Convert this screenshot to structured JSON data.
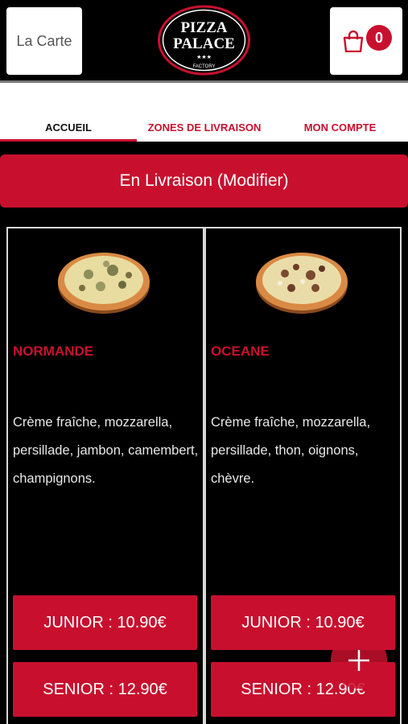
{
  "header": {
    "carte_label": "La Carte",
    "logo_text_line1": "PIZZA",
    "logo_text_line2": "PALACE",
    "logo_stars": "★★★",
    "logo_sub": "FACTORY",
    "cart_count": "0"
  },
  "nav": {
    "tabs": [
      {
        "label": "ACCUEIL"
      },
      {
        "label": "ZONES DE LIVRAISON"
      },
      {
        "label": "MON COMPTE"
      }
    ]
  },
  "delivery": {
    "label": "En Livraison (Modifier)"
  },
  "products": [
    {
      "name": "NORMANDE",
      "description": "Crème fraîche, mozzarella, persillade, jambon, camembert, champignons.",
      "junior": "JUNIOR : 10.90€",
      "senior": "SENIOR : 12.90€"
    },
    {
      "name": "OCEANE",
      "description": "Crème fraîche, mozzarella, persillade, thon, oignons, chèvre.",
      "junior": "JUNIOR : 10.90€",
      "senior": "SENIOR : 12.90€"
    }
  ],
  "colors": {
    "accent": "#c8102e",
    "background": "#000000"
  },
  "icons": {
    "cart": "shopping-bag-icon",
    "fab": "plus-icon"
  }
}
